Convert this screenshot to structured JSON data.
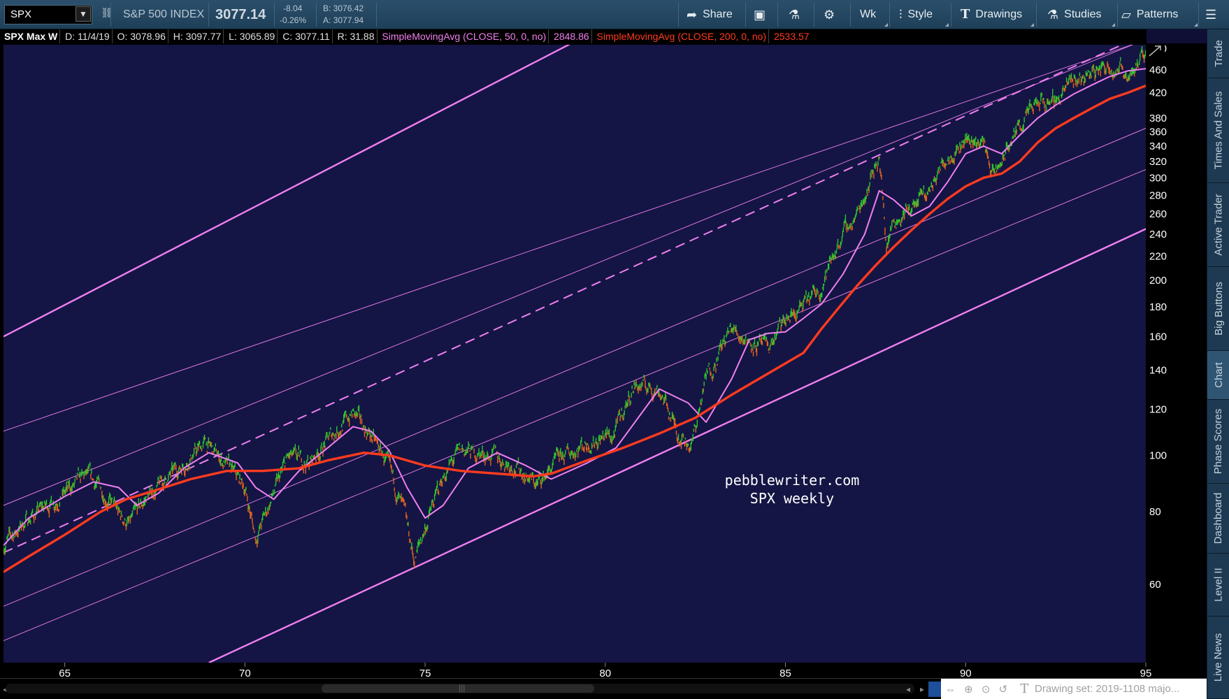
{
  "toolbar": {
    "symbol": "SPX",
    "index_name": "S&P 500 INDEX",
    "last_price": "3077.14",
    "change": "-8.04",
    "change_pct": "-0.26%",
    "bid": "B: 3076.42",
    "ask": "A: 3077.94",
    "share_label": "Share",
    "aggregation": "Wk",
    "style_label": "Style",
    "drawings_label": "Drawings",
    "studies_label": "Studies",
    "patterns_label": "Patterns"
  },
  "study_header": {
    "name": "SPX Max W",
    "date": "D: 11/4/19",
    "open": "O: 3078.96",
    "high": "H: 3097.77",
    "low": "L: 3065.89",
    "close": "C: 3077.11",
    "range": "R: 31.88",
    "sma50_label": "SimpleMovingAvg (CLOSE, 50, 0, no)",
    "sma50_value": "2848.86",
    "sma200_label": "SimpleMovingAvg (CLOSE, 200, 0, no)",
    "sma200_value": "2533.57",
    "sma50_color": "#f07ff0",
    "sma200_color": "#ff3b1f"
  },
  "chart_data": {
    "type": "line",
    "scale": "log",
    "grid": false,
    "xlim": [
      1963.3,
      1995.0
    ],
    "ylim": [
      44,
      508
    ],
    "x_ticks": [
      65,
      70,
      75,
      80,
      85,
      90,
      95
    ],
    "y_ticks": [
      60,
      80,
      100,
      120,
      140,
      160,
      180,
      200,
      220,
      240,
      260,
      280,
      300,
      320,
      340,
      360,
      380,
      420,
      460,
      500
    ],
    "annotation": [
      "pebblewriter.com",
      "SPX weekly"
    ],
    "colors": {
      "background": "#141544",
      "channel": "#f07ff0",
      "price_up": "#2ec42e",
      "price_down": "#e0641e",
      "sma50": "#f07ff0",
      "sma200": "#ff3b1f"
    },
    "series": [
      {
        "kind": "price",
        "x": [
          1963.3,
          1964.0,
          1965.0,
          1965.6,
          1966.0,
          1966.5,
          1966.8,
          1967.3,
          1968.0,
          1968.9,
          1969.5,
          1970.0,
          1970.3,
          1970.6,
          1971.2,
          1971.8,
          1972.5,
          1973.0,
          1973.5,
          1973.9,
          1974.4,
          1974.7,
          1975.0,
          1975.5,
          1976.0,
          1976.8,
          1977.5,
          1978.1,
          1978.7,
          1979.3,
          1980.0,
          1980.2,
          1980.8,
          1981.5,
          1982.0,
          1982.4,
          1982.8,
          1983.5,
          1984.0,
          1984.5,
          1985.0,
          1985.5,
          1986.0,
          1986.5,
          1987.0,
          1987.6,
          1987.8,
          1988.0,
          1988.5,
          1989.0,
          1989.5,
          1990.0,
          1990.5,
          1990.8,
          1991.0,
          1991.5,
          1992.0,
          1992.5,
          1993.0,
          1993.5,
          1994.0,
          1994.5,
          1995.0
        ],
        "y": [
          70,
          78,
          86,
          92,
          88,
          79,
          76,
          85,
          93,
          105,
          96,
          88,
          72,
          80,
          99,
          97,
          110,
          118,
          108,
          98,
          80,
          66,
          75,
          92,
          102,
          100,
          96,
          89,
          98,
          104,
          108,
          107,
          132,
          130,
          110,
          104,
          136,
          165,
          158,
          152,
          170,
          180,
          195,
          235,
          260,
          330,
          230,
          255,
          265,
          285,
          330,
          350,
          345,
          300,
          320,
          370,
          400,
          410,
          440,
          455,
          470,
          455,
          485
        ]
      },
      {
        "name": "SimpleMovingAvg (CLOSE, 50, 0, no)",
        "kind": "sma50",
        "x": [
          1963.3,
          1964.0,
          1965.0,
          1965.8,
          1966.5,
          1967.0,
          1967.6,
          1968.3,
          1969.0,
          1969.8,
          1970.3,
          1970.8,
          1971.5,
          1972.3,
          1973.0,
          1973.5,
          1974.0,
          1974.5,
          1975.0,
          1975.5,
          1976.2,
          1977.0,
          1977.8,
          1978.5,
          1979.5,
          1980.3,
          1981.0,
          1981.5,
          1982.3,
          1982.8,
          1983.5,
          1984.0,
          1984.5,
          1985.0,
          1985.5,
          1986.0,
          1986.6,
          1987.2,
          1987.6,
          1988.0,
          1988.5,
          1989.0,
          1989.5,
          1990.0,
          1990.5,
          1991.0,
          1991.5,
          1992.0,
          1992.5,
          1993.0,
          1993.5,
          1994.0,
          1994.5,
          1995.0
        ],
        "y": [
          70,
          78,
          85,
          90,
          88,
          82,
          86,
          95,
          101,
          97,
          88,
          84,
          94,
          103,
          112,
          110,
          102,
          88,
          78,
          82,
          95,
          101,
          96,
          91,
          97,
          103,
          118,
          130,
          123,
          114,
          135,
          158,
          162,
          163,
          172,
          182,
          205,
          240,
          285,
          275,
          258,
          268,
          295,
          330,
          340,
          330,
          355,
          380,
          400,
          418,
          433,
          448,
          458,
          462
        ]
      },
      {
        "name": "SimpleMovingAvg (CLOSE, 200, 0, no)",
        "kind": "sma200",
        "x": [
          1963.3,
          1964.0,
          1965.0,
          1966.0,
          1966.7,
          1967.5,
          1968.5,
          1969.5,
          1970.5,
          1971.5,
          1972.3,
          1973.3,
          1974.0,
          1975.0,
          1976.0,
          1977.0,
          1978.0,
          1978.5,
          1979.5,
          1980.5,
          1981.5,
          1982.5,
          1983.5,
          1984.5,
          1985.5,
          1986.0,
          1986.5,
          1987.0,
          1987.5,
          1988.0,
          1988.5,
          1989.0,
          1989.5,
          1990.0,
          1990.5,
          1991.0,
          1991.5,
          1992.0,
          1992.5,
          1993.0,
          1993.5,
          1994.0,
          1994.5,
          1995.0
        ],
        "y": [
          63,
          67,
          73,
          80,
          84,
          87,
          91,
          94,
          94,
          95,
          98,
          101,
          100,
          96,
          94,
          93,
          92,
          93,
          98,
          103,
          109,
          116,
          127,
          138,
          150,
          165,
          180,
          196,
          212,
          228,
          244,
          260,
          276,
          290,
          300,
          305,
          320,
          345,
          365,
          380,
          395,
          410,
          420,
          432
        ]
      }
    ],
    "channels": [
      {
        "style": "bold",
        "x": [
          1963.3,
          1979.3
        ],
        "y": [
          160,
          520
        ]
      },
      {
        "style": "thin",
        "x": [
          1963.3,
          1994.7
        ],
        "y": [
          110,
          510
        ]
      },
      {
        "style": "dashed",
        "x": [
          1963.3,
          1994.7
        ],
        "y": [
          68,
          520
        ]
      },
      {
        "style": "thin",
        "x": [
          1963.3,
          1994.7
        ],
        "y": [
          82,
          510
        ]
      },
      {
        "style": "thin",
        "x": [
          1963.3,
          1995.0
        ],
        "y": [
          55,
          365
        ]
      },
      {
        "style": "thin",
        "x": [
          1963.3,
          1995.0
        ],
        "y": [
          48,
          310
        ]
      },
      {
        "style": "bold",
        "x": [
          1969.0,
          1995.0
        ],
        "y": [
          44,
          245
        ]
      }
    ]
  },
  "side_tabs": [
    "Trade",
    "Times And Sales",
    "Active Trader",
    "Big Buttons",
    "Chart",
    "Phase Scores",
    "Dashboard",
    "Level II",
    "Live News"
  ],
  "side_tab_active": "Chart",
  "bottom": {
    "drawing_set": "Drawing set: 2019-1108 majo..."
  }
}
